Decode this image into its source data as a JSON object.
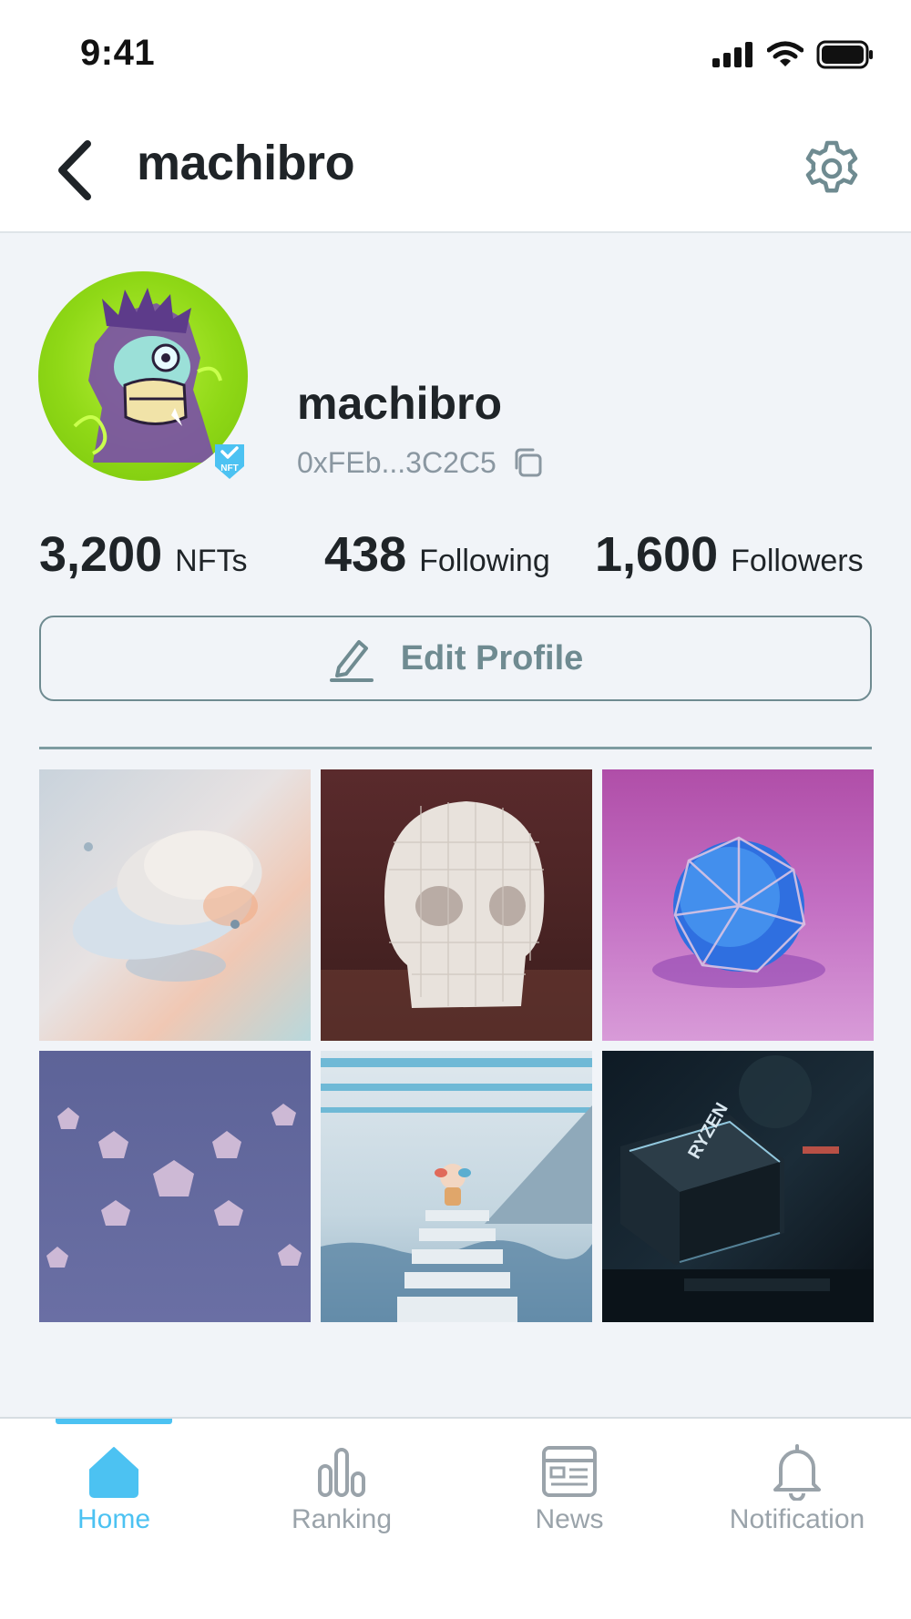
{
  "status_bar": {
    "time": "9:41"
  },
  "header": {
    "title": "machibro"
  },
  "profile": {
    "name": "machibro",
    "wallet_address": "0xFEb...3C2C5",
    "badge_text": "NFT"
  },
  "stats": [
    {
      "value": "3,200",
      "label": "NFTs"
    },
    {
      "value": "438",
      "label": "Following"
    },
    {
      "value": "1,600",
      "label": "Followers"
    }
  ],
  "edit_profile": {
    "label": "Edit Profile"
  },
  "gallery": [
    {
      "icon": "abstract-discs-artwork"
    },
    {
      "icon": "wire-skull-artwork"
    },
    {
      "icon": "crystal-sphere-artwork"
    },
    {
      "icon": "floating-dice-artwork"
    },
    {
      "icon": "monkey-staircase-artwork"
    },
    {
      "icon": "ryzen-gpu-artwork"
    }
  ],
  "tabs": [
    {
      "label": "Home",
      "icon": "home-icon",
      "active": true
    },
    {
      "label": "Ranking",
      "icon": "ranking-icon",
      "active": false
    },
    {
      "label": "News",
      "icon": "news-icon",
      "active": false
    },
    {
      "label": "Notification",
      "icon": "bell-icon",
      "active": false
    }
  ],
  "colors": {
    "accent": "#4cc2f2",
    "muted_teal": "#6f8b91",
    "background": "#f1f4f8",
    "text_dark": "#1f2428"
  }
}
